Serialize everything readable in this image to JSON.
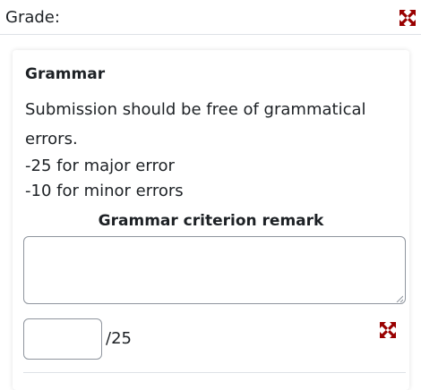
{
  "grade": {
    "label": "Grade:",
    "expand_icon": "expand-arrows-icon"
  },
  "criterion": {
    "title": "Grammar",
    "description": "Submission should be free of grammatical errors.",
    "rules": [
      "-25 for major error",
      "-10 for minor errors"
    ],
    "remark_label": "Grammar criterion remark",
    "remark_value": "",
    "score_value": "",
    "score_max": "/25",
    "expand_icon": "expand-arrows-icon"
  },
  "colors": {
    "icon_red": "#990000",
    "text": "#1d2125",
    "border": "#8f959e"
  }
}
